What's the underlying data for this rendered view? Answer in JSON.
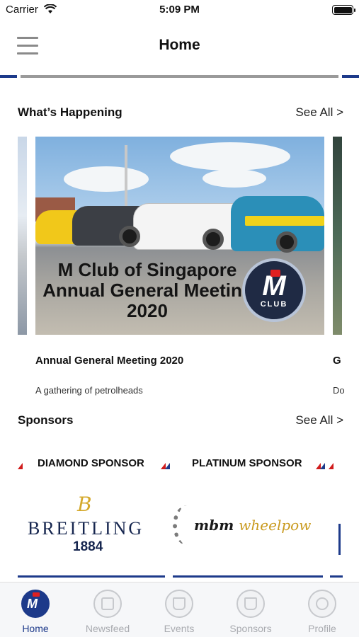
{
  "status_bar": {
    "carrier": "Carrier",
    "time": "5:09 PM"
  },
  "nav": {
    "title": "Home"
  },
  "happening": {
    "title": "What’s Happening",
    "see_all": "See All >",
    "events": [
      {
        "image_line1": "M Club of Singapore",
        "image_line2": "Annual General Meeting",
        "image_line3": "2020",
        "badge_m": "M",
        "badge_club": "CLUB",
        "title": "Annual General Meeting 2020",
        "subtitle": "A gathering of petrolheads"
      },
      {
        "title": "G",
        "subtitle": "Do"
      }
    ]
  },
  "sponsors": {
    "title": "Sponsors",
    "see_all": "See All >",
    "tiers": [
      {
        "label": "DIAMOND SPONSOR",
        "logo_mark": "B",
        "logo_name": "BREITLING",
        "logo_year": "1884"
      },
      {
        "label": "PLATINUM SPONSOR",
        "logo_name": "mbm",
        "logo_accent": "wheelpow"
      }
    ]
  },
  "tabs": [
    {
      "label": "Home",
      "icon": "club-logo-icon",
      "active": true
    },
    {
      "label": "Newsfeed",
      "icon": "newspaper-icon",
      "active": false
    },
    {
      "label": "Events",
      "icon": "store-icon",
      "active": false
    },
    {
      "label": "Sponsors",
      "icon": "store-icon",
      "active": false
    },
    {
      "label": "Profile",
      "icon": "user-settings-icon",
      "active": false
    }
  ],
  "colors": {
    "accent": "#1d3a8a",
    "tier_marker": "#d01c1c",
    "tab_inactive": "#a9abb0"
  }
}
